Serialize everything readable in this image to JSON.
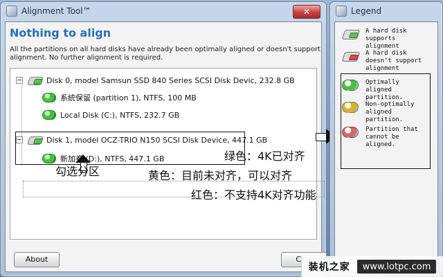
{
  "main_window": {
    "title": "Alignment Tool™",
    "headline": "Nothing to align",
    "message": "All the partitions on all hard disks have already been optimally aligned or doesn't support alignment. No further alignment is required.",
    "tree": [
      {
        "label": "Disk 0, model Samsun  SSD 840 Series SCSI Disk Devic, 232.8 GB"
      },
      {
        "label": "系統保留 (partition 1), NTFS, 100 MB"
      },
      {
        "label": "Local Disk (C:), NTFS, 232.7 GB"
      },
      {
        "label": "Disk 1, model OCZ-TRIO N150 SCSI Disk Device, 447.1 GB"
      },
      {
        "label": "新加卷 (D:), NTFS, 447.1 GB"
      }
    ],
    "buttons": {
      "about": "About",
      "close": "Clos"
    }
  },
  "legend_window": {
    "title": "Legend",
    "items": [
      {
        "label": "A hard disk supports alignment",
        "color": "#58c24e"
      },
      {
        "label": "A hard disk doesn't support alignment",
        "color": "#d24a4a"
      },
      {
        "label": "Optimally aligned partition.",
        "color": "#4bbf45"
      },
      {
        "label": "Non-optimally aligned partition.",
        "color": "#d9b233"
      },
      {
        "label": "Partition that cannot be aligned.",
        "color": "#d26a6a"
      }
    ]
  },
  "annotations": {
    "select_partition": "勾选分区",
    "green": "绿色：4K已对齐",
    "yellow": "黄色：目前未对齐，可以对齐",
    "red": "红色：不支持4K对齐功能"
  },
  "watermark": {
    "left": "装机之家",
    "right": "www.lotpc.com"
  }
}
